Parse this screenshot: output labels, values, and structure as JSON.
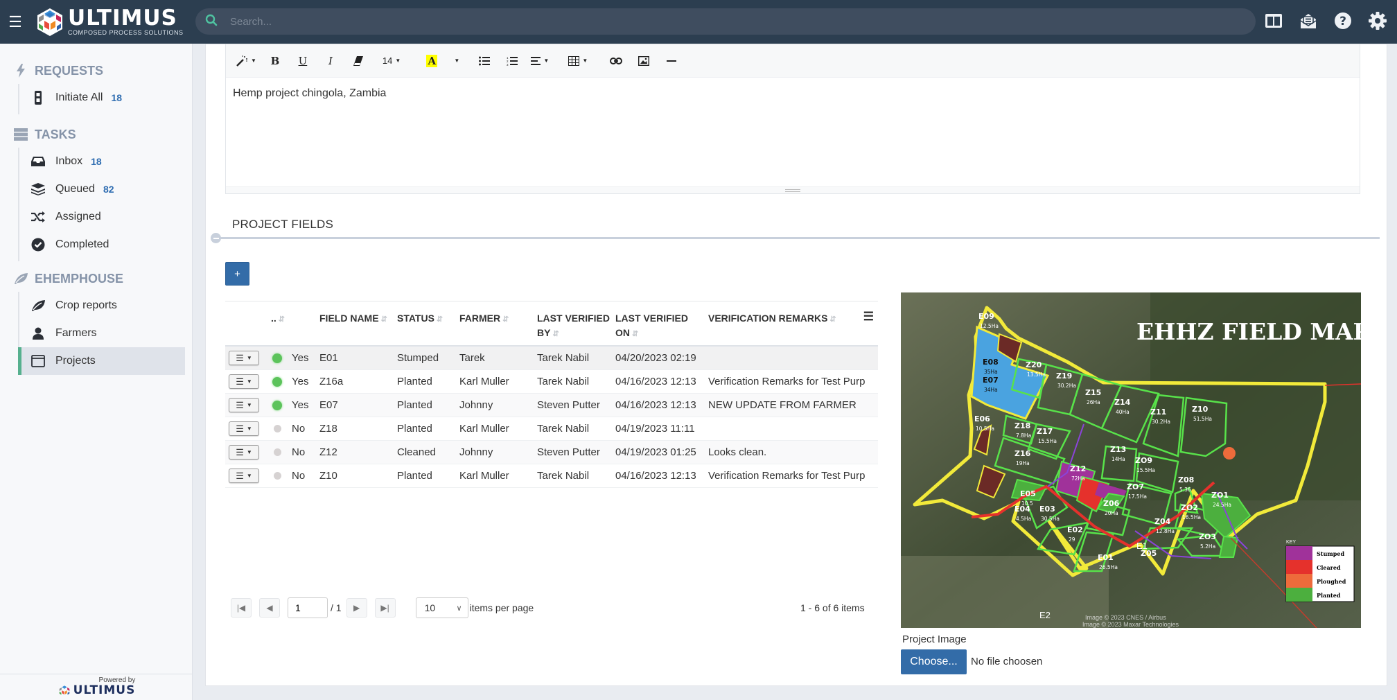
{
  "header": {
    "logo_text": "ULTIMUS",
    "logo_tagline": "Composed Process Solutions",
    "search_placeholder": "Search...",
    "icons": [
      "split-view-icon",
      "mail-open-icon",
      "help-icon",
      "gear-icon"
    ]
  },
  "sidebar": {
    "sections": [
      {
        "title": "REQUESTS",
        "icon": "bolt-icon",
        "items": [
          {
            "label": "Initiate All",
            "count": "18",
            "icon": "traffic-light-icon"
          }
        ]
      },
      {
        "title": "TASKS",
        "icon": "server-icon",
        "items": [
          {
            "label": "Inbox",
            "count": "18",
            "icon": "inbox-icon"
          },
          {
            "label": "Queued",
            "count": "82",
            "icon": "layers-icon"
          },
          {
            "label": "Assigned",
            "count": "",
            "icon": "shuffle-icon"
          },
          {
            "label": "Completed",
            "count": "",
            "icon": "check-circle-icon"
          }
        ]
      },
      {
        "title": "EHEMPHOUSE",
        "icon": "leaf-icon",
        "items": [
          {
            "label": "Crop reports",
            "count": "",
            "icon": "leaf-icon"
          },
          {
            "label": "Farmers",
            "count": "",
            "icon": "user-icon"
          },
          {
            "label": "Projects",
            "count": "",
            "icon": "window-icon",
            "active": true
          }
        ]
      }
    ],
    "footer": {
      "powered_by": "Powered by",
      "brand": "ULTIMUS"
    }
  },
  "editor": {
    "font_size": "14",
    "content": "Hemp project chingola, Zambia",
    "toolbar": {
      "bold": "B",
      "underline": "U",
      "italic": "I",
      "highlight": "A"
    }
  },
  "project_fields": {
    "title": "PROJECT FIELDS",
    "add_label": "+",
    "columns": [
      "..",
      "FIELD NAME",
      "STATUS",
      "FARMER",
      "LAST VERIFIED BY",
      "LAST VERIFIED ON",
      "VERIFICATION REMARKS"
    ],
    "columns_split": {
      "verified_by": [
        "LAST VERIFIED",
        "BY"
      ],
      "verified_on": [
        "LAST VERIFIED",
        "ON"
      ]
    },
    "rows": [
      {
        "active": "Yes",
        "field": "E01",
        "status": "Stumped",
        "farmer": "Tarek",
        "verified_by": "Tarek Nabil",
        "verified_on": "04/20/2023 02:19",
        "remarks": ""
      },
      {
        "active": "Yes",
        "field": "Z16a",
        "status": "Planted",
        "farmer": "Karl Muller",
        "verified_by": "Tarek Nabil",
        "verified_on": "04/16/2023 12:13",
        "remarks": "Verification Remarks for Test Purp"
      },
      {
        "active": "Yes",
        "field": "E07",
        "status": "Planted",
        "farmer": "Johnny",
        "verified_by": "Steven Putter",
        "verified_on": "04/16/2023 12:13",
        "remarks": "NEW UPDATE FROM FARMER"
      },
      {
        "active": "No",
        "field": "Z18",
        "status": "Planted",
        "farmer": "Karl Muller",
        "verified_by": "Tarek Nabil",
        "verified_on": "04/19/2023 11:11",
        "remarks": ""
      },
      {
        "active": "No",
        "field": "Z12",
        "status": "Cleaned",
        "farmer": "Johnny",
        "verified_by": "Steven Putter",
        "verified_on": "04/19/2023 01:25",
        "remarks": "Looks clean."
      },
      {
        "active": "No",
        "field": "Z10",
        "status": "Planted",
        "farmer": "Karl Muller",
        "verified_by": "Tarek Nabil",
        "verified_on": "04/16/2023 12:13",
        "remarks": "Verification Remarks for Test Purp"
      }
    ],
    "pager": {
      "page": "1",
      "of_pages": "/ 1",
      "page_size": "10",
      "items_per_page": "items per page",
      "summary": "1 - 6 of 6 items"
    }
  },
  "project_image": {
    "label": "Project Image",
    "choose_label": "Choose...",
    "file_status": "No file choosen",
    "map": {
      "title": "EHHZ FIELD MAP",
      "credits": [
        "Image © 2023 CNES / Airbus",
        "Image © 2023 Maxar Technologies"
      ],
      "legend_title": "KEY",
      "legend": [
        {
          "label": "Stumped",
          "color": "#a0329a"
        },
        {
          "label": "Cleared",
          "color": "#e5312c"
        },
        {
          "label": "Ploughed",
          "color": "#ee6b3b"
        },
        {
          "label": "Planted",
          "color": "#4caf3e"
        }
      ],
      "fields": [
        {
          "name": "E09",
          "area": "12.5Ha"
        },
        {
          "name": "E08",
          "area": "35Ha"
        },
        {
          "name": "E07",
          "area": "34Ha"
        },
        {
          "name": "E06",
          "area": "10.5Ha"
        },
        {
          "name": "E05",
          "area": "10.5"
        },
        {
          "name": "E04",
          "area": "4.5Ha"
        },
        {
          "name": "E03",
          "area": "30.5Ha"
        },
        {
          "name": "E02",
          "area": "29"
        },
        {
          "name": "E01",
          "area": "26.5Ha"
        },
        {
          "name": "Z20",
          "area": "13.5Ha"
        },
        {
          "name": "Z19",
          "area": "30.2Ha"
        },
        {
          "name": "Z18",
          "area": "7.8Ha"
        },
        {
          "name": "Z17",
          "area": "15.5Ha"
        },
        {
          "name": "Z16",
          "area": "19Ha"
        },
        {
          "name": "Z15",
          "area": "26Ha"
        },
        {
          "name": "Z14",
          "area": "40Ha"
        },
        {
          "name": "Z13",
          "area": "14Ha"
        },
        {
          "name": "Z12",
          "area": "72Ha"
        },
        {
          "name": "Z11",
          "area": "30.2Ha"
        },
        {
          "name": "Z10",
          "area": "51.5Ha"
        },
        {
          "name": "ZO9",
          "area": "15.5Ha"
        },
        {
          "name": "Z08",
          "area": "5.36"
        },
        {
          "name": "ZO7",
          "area": "17.5Ha"
        },
        {
          "name": "Z06",
          "area": "20Ha"
        },
        {
          "name": "Z05",
          "area": ""
        },
        {
          "name": "Z04",
          "area": "12.8Ha"
        },
        {
          "name": "ZO3",
          "area": "5.2Ha"
        },
        {
          "name": "ZO2",
          "area": "16.5Ha"
        },
        {
          "name": "ZO1",
          "area": "24.5Ha"
        }
      ],
      "markers": [
        "E1",
        "E2"
      ]
    }
  }
}
